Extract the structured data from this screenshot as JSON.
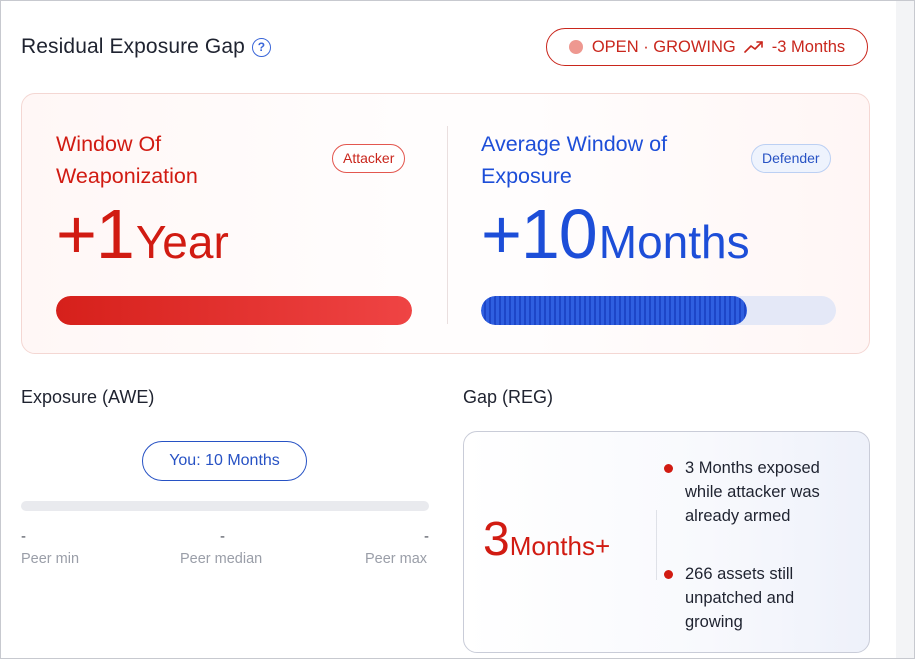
{
  "header": {
    "title": "Residual Exposure Gap",
    "help_icon": "question-circle-icon",
    "status": {
      "text": "OPEN · GROWING",
      "trend_icon": "trending-up-icon",
      "trend_text": "-3 Months",
      "color": "#c9261c"
    }
  },
  "attacker": {
    "title_line1": "Window Of",
    "title_line2": "Weaponization",
    "badge": "Attacker",
    "value": "+1",
    "unit": "Year",
    "color": "#d11b12",
    "bar_fill_fraction": 1.0
  },
  "defender": {
    "title_line1": "Average Window of",
    "title_line2": "Exposure",
    "badge": "Defender",
    "value": "+10",
    "unit": "Months",
    "color": "#1d4ed8",
    "bar_fill_fraction": 0.75
  },
  "exposure": {
    "label": "Exposure (AWE)",
    "you_label": "You: 10 Months",
    "peer_min_value": "-",
    "peer_median_value": "-",
    "peer_max_value": "-",
    "peer_min_label": "Peer min",
    "peer_median_label": "Peer median",
    "peer_max_label": "Peer max"
  },
  "gap": {
    "label": "Gap (REG)",
    "value": "3",
    "unit": "Months+",
    "bullets": [
      "3 Months exposed while attacker was already armed",
      "266 assets still unpatched and growing"
    ]
  }
}
